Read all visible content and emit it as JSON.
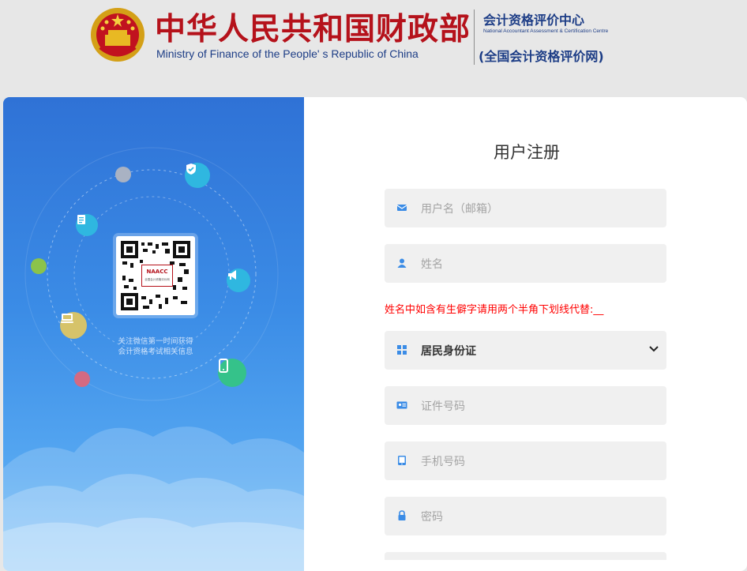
{
  "header": {
    "title_cn": "中华人民共和国财政部",
    "title_en": "Ministry of Finance of the People' s Republic of China",
    "center_cn": "会计资格评价中心",
    "center_en": "National Accountant Assessment & Certification Centre",
    "site_cn": "(全国会计资格评价网)"
  },
  "left_panel": {
    "qr_badge": "NAACC",
    "qr_badge_sub": "全国会计资格评价网",
    "follow_line1": "关注微信第一时间获得",
    "follow_line2": "会计资格考试相关信息",
    "icons": [
      "shield-icon",
      "document-icon",
      "megaphone-icon",
      "mobile-icon",
      "computer-icon"
    ]
  },
  "form": {
    "title": "用户注册",
    "username_placeholder": "用户名（邮箱）",
    "name_placeholder": "姓名",
    "name_notice": "姓名中如含有生僻字请用两个半角下划线代替:__",
    "id_type_selected": "居民身份证",
    "id_number_placeholder": "证件号码",
    "phone_placeholder": "手机号码",
    "password_placeholder": "密码"
  },
  "colors": {
    "brand_red": "#b5121b",
    "brand_blue": "#1d3d86",
    "panel_blue": "#3b8ce6",
    "notice_red": "#ff0000",
    "field_bg": "#f0f0f0"
  }
}
